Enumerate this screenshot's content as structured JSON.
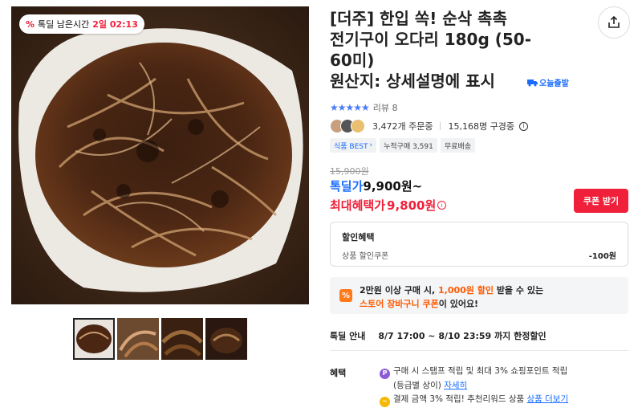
{
  "timer": {
    "label": "톡딜 남은시간",
    "remaining": "2일 02:13"
  },
  "product": {
    "title": "[더주] 한입 쏙! 순삭 촉촉 전기구이 오다리 180g (50-60미) 원산지: 상세설명에 표시",
    "title_line1": "[더주] 한입 쏙! 순삭 촉촉",
    "title_line2": "전기구이 오다리 180g (50-",
    "title_line3": "60미)",
    "title_line4": "원산지: 상세설명에 표시",
    "shipping_badge": "오늘출발"
  },
  "rating": {
    "stars": "★★★★★",
    "review_text": "리뷰 8"
  },
  "stats": {
    "orders": "3,472개 주문중",
    "subscribers": "15,168명 구경중"
  },
  "chips": [
    {
      "label": "식품 BEST",
      "has_chevron": true
    },
    {
      "label": "누적구매 3,591"
    },
    {
      "label": "무료배송"
    }
  ],
  "price": {
    "original": "15,900원",
    "deal_label": "톡딜가",
    "deal_value": "9,900원~",
    "max_label": "최대혜택가",
    "max_value": "9,800원",
    "coupon_button": "쿠폰 받기"
  },
  "discount": {
    "heading": "할인혜택",
    "item_label": "상품 할인쿠폰",
    "item_value": "-100원"
  },
  "promo": {
    "icon": "%",
    "line1_a": "2만원 이상 구매 시, ",
    "line1_hl": "1,000원 할인",
    "line1_b": " 받을 수 있는",
    "line2_hl": "스토어 장바구니 쿠폰",
    "line2_b": "이 있어요!"
  },
  "deal_info": {
    "label": "톡딜 안내",
    "value": "8/7 17:00 ~ 8/10 23:59 까지 한정할인"
  },
  "benefit": {
    "label": "혜택",
    "row1_text": "구매 시 스탬프 적립 및 최대 3% 쇼핑포인트 적립",
    "row1_sub": "(등급별 상이)",
    "row1_link": "자세히",
    "row2_text": "결제 금액 3% 적립! 추천리워드 상품",
    "row2_link": "상품 더보기"
  },
  "colors": {
    "accent_blue": "#1a6cff",
    "accent_red": "#f0203a",
    "accent_orange": "#ff5a00"
  },
  "icons": [
    "share-icon",
    "info-icon",
    "star-icon",
    "truck-icon",
    "coin-icon",
    "percent-icon"
  ]
}
